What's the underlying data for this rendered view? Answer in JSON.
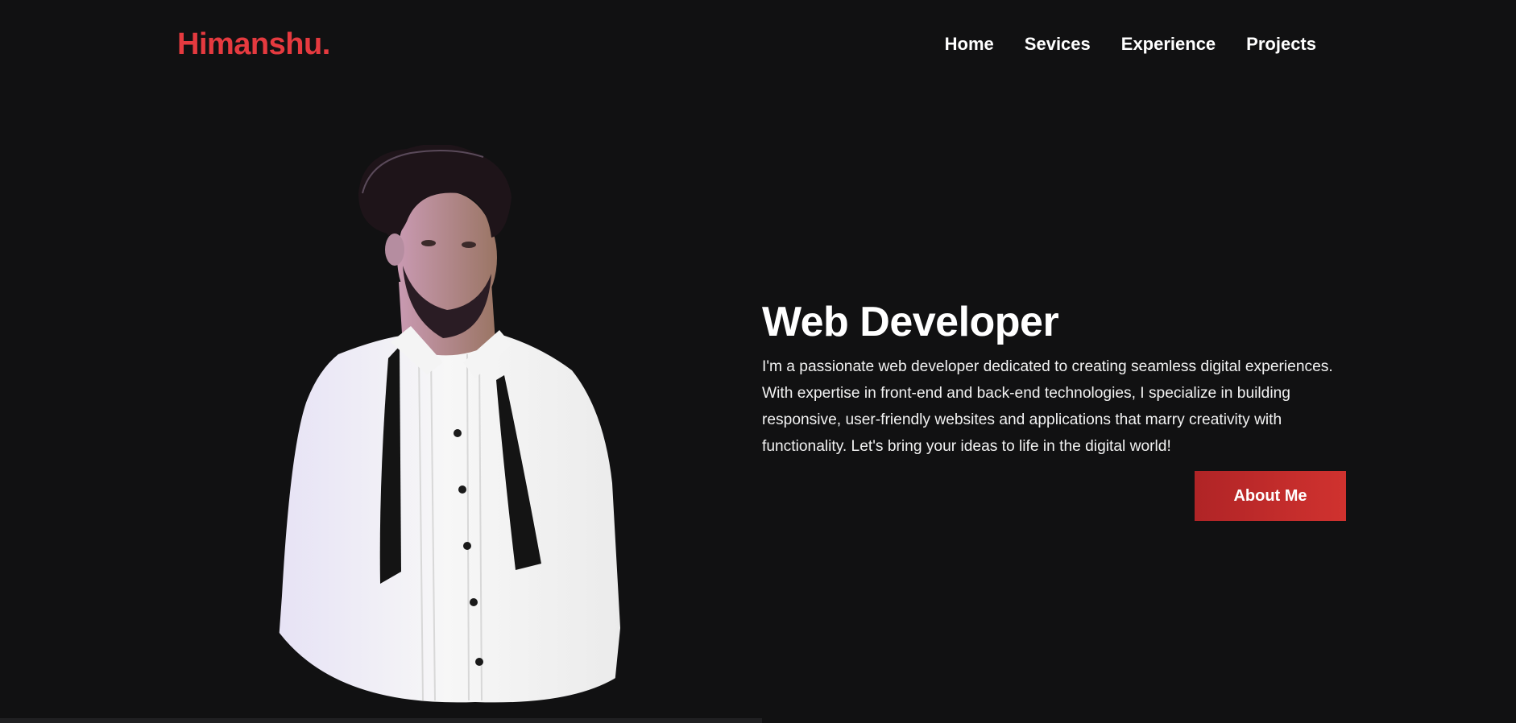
{
  "header": {
    "logo": "Himanshu.",
    "nav": [
      {
        "label": "Home"
      },
      {
        "label": "Sevices"
      },
      {
        "label": "Experience"
      },
      {
        "label": "Projects"
      }
    ]
  },
  "hero": {
    "title": "Web Developer",
    "description": "I'm a passionate web developer dedicated to creating seamless digital experiences. With expertise in front-end and back-end technologies, I specialize in building responsive, user-friendly websites and applications that marry creativity with functionality. Let's bring your ideas to life in the digital world!",
    "button_label": "About Me"
  },
  "colors": {
    "background": "#111112",
    "accent": "#e53a3f",
    "button": "#c22b2b"
  }
}
